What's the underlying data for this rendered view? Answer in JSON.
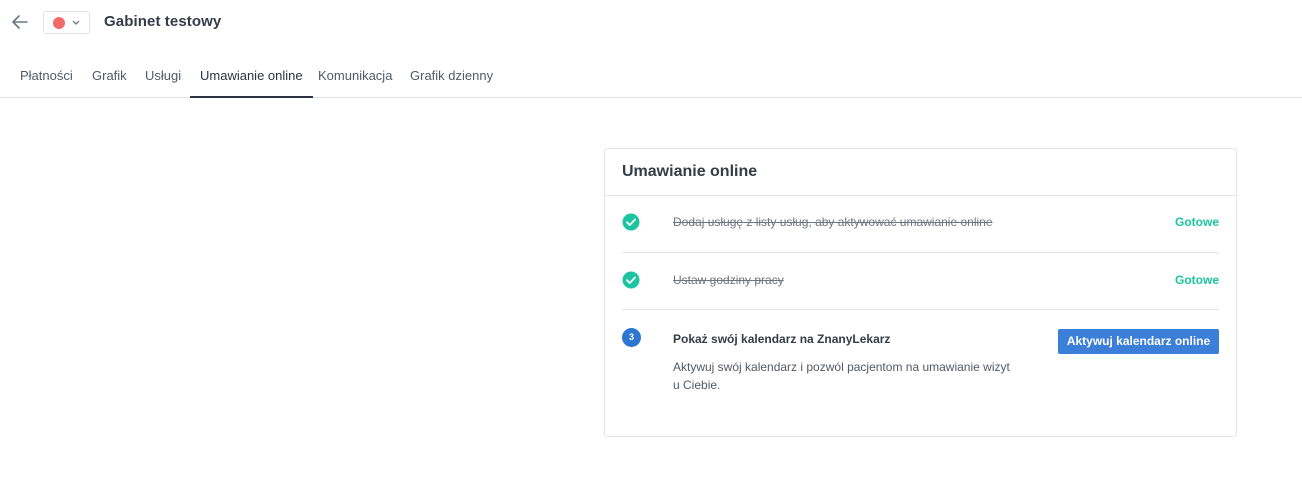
{
  "header": {
    "back_icon": "arrow-left-icon",
    "color_dot": "#f06a6a",
    "chevron_icon": "chevron-down-icon",
    "title": "Gabinet testowy"
  },
  "tabs": [
    {
      "label": "Płatności",
      "active": false
    },
    {
      "label": "Grafik",
      "active": false
    },
    {
      "label": "Usługi",
      "active": false
    },
    {
      "label": "Umawianie online",
      "active": true
    },
    {
      "label": "Komunikacja",
      "active": false
    },
    {
      "label": "Grafik dzienny",
      "active": false
    }
  ],
  "card": {
    "title": "Umawianie online",
    "steps": [
      {
        "text": "Dodaj usługę z listy usług, aby aktywować umawianie online",
        "status": "Gotowe",
        "icon": "check-circle-icon"
      },
      {
        "text": "Ustaw godziny pracy",
        "status": "Gotowe",
        "icon": "check-circle-icon"
      }
    ],
    "step3": {
      "number": "3",
      "title": "Pokaż swój kalendarz na ZnanyLekarz",
      "description": "Aktywuj swój kalendarz i pozwól pacjentom na umawianie wizyt u Ciebie.",
      "button": "Aktywuj kalendarz online"
    }
  },
  "colors": {
    "done": "#1cc4a0",
    "primary": "#3b7fd8",
    "text": "#333d47"
  }
}
